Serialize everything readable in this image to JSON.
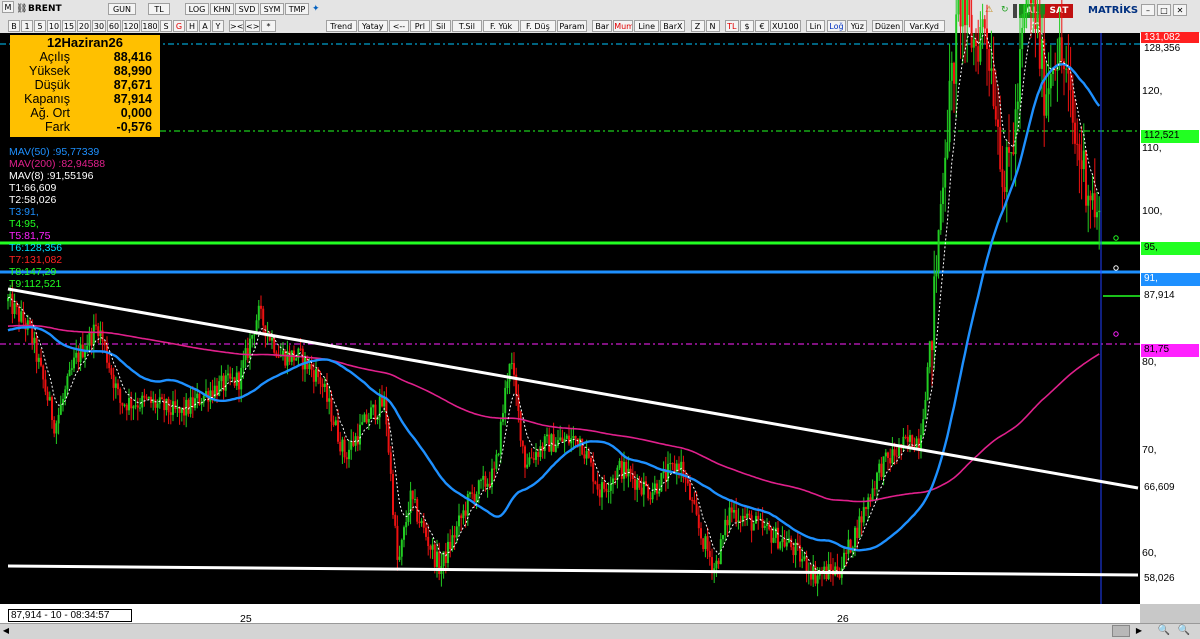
{
  "toolbar": {
    "menu_icon": "M",
    "symbol": "BRENT",
    "period_tabs": [
      "GUN",
      "TL",
      "LOG",
      "KHN",
      "SVD",
      "SYM",
      "TMP"
    ],
    "row2_left": [
      "B",
      "1",
      "5",
      "10",
      "15",
      "20",
      "30",
      "60",
      "120",
      "180",
      "S",
      "G",
      "H",
      "A",
      "Y"
    ],
    "nav_buttons": [
      "><",
      "<>",
      "*"
    ],
    "row2_buttons": [
      "Trend",
      "Yatay",
      "<--",
      "Prl",
      "Sil",
      "T.Sil",
      "F. Yük",
      "F. Düş",
      "Param",
      "Bar",
      "Mum",
      "Line",
      "BarX",
      "Z",
      "N",
      "TL",
      "$",
      "€",
      "XU100",
      "Lin",
      "Loğ",
      "Yüz",
      "Düzen",
      "Var.Kyd"
    ],
    "al_label": "AL",
    "sat_label": "SAT",
    "matriks_label": "MATRİKS"
  },
  "info_box": {
    "title": "12Haziran26",
    "rows": [
      {
        "label": "Açılış",
        "value": "88,416"
      },
      {
        "label": "Yüksek",
        "value": "88,990"
      },
      {
        "label": "Düşük",
        "value": "87,671"
      },
      {
        "label": "Kapanış",
        "value": "87,914"
      },
      {
        "label": "Ağ. Ort",
        "value": "0,000"
      },
      {
        "label": "Fark",
        "value": "-0,576"
      }
    ]
  },
  "indicators": [
    {
      "text": "MAV(50)    :95,77339",
      "color": "#1e90ff"
    },
    {
      "text": "MAV(200)   :82,94588",
      "color": "#e0208c"
    },
    {
      "text": "MAV(8)       :91,55196",
      "color": "#ffffff"
    },
    {
      "text": "T1:66,609",
      "color": "#ffffff"
    },
    {
      "text": "T2:58,026",
      "color": "#ffffff"
    },
    {
      "text": "T3:91,",
      "color": "#1e90ff"
    },
    {
      "text": "T4:95,",
      "color": "#22ff22"
    },
    {
      "text": "T5:81,75",
      "color": "#ff22ff"
    },
    {
      "text": "T6:128,356",
      "color": "#00e0ff"
    },
    {
      "text": "T7:131,082",
      "color": "#ff2222"
    },
    {
      "text": "T8:147,29",
      "color": "#22ff22"
    },
    {
      "text": "T9:112,521",
      "color": "#22ff22"
    }
  ],
  "y_axis_ticks": [
    "120,",
    "110,",
    "100,",
    "80,",
    "70,",
    "60,"
  ],
  "x_axis_ticks": [
    "25",
    "26"
  ],
  "price_tags": [
    {
      "id": "t7",
      "text": "131,082",
      "bg": "#ff2020",
      "fg": "#ffffff"
    },
    {
      "id": "t6",
      "text": "128,356",
      "bg": "#ffffff",
      "fg": "#000000"
    },
    {
      "id": "t9",
      "text": "112,521",
      "bg": "#22ff22",
      "fg": "#000000"
    },
    {
      "id": "t4",
      "text": "95,",
      "bg": "#22ff22",
      "fg": "#000000"
    },
    {
      "id": "t3",
      "text": "91,",
      "bg": "#1e90ff",
      "fg": "#ffffff"
    },
    {
      "id": "last",
      "text": "87,914",
      "bg": "#ffffff",
      "fg": "#000000"
    },
    {
      "id": "t5",
      "text": "81,75",
      "bg": "#ff22ff",
      "fg": "#000000"
    },
    {
      "id": "t1",
      "text": "66,609",
      "bg": "#ffffff",
      "fg": "#000000"
    },
    {
      "id": "t2",
      "text": "58,026",
      "bg": "#ffffff",
      "fg": "#000000"
    }
  ],
  "status_text": "87,914 - 10 - 08:34:57",
  "colors": {
    "background": "#000000",
    "candle_up": "#22cc22",
    "candle_down": "#ee1111",
    "mav50": "#1e90ff",
    "mav200": "#e0208c",
    "mav8": "#ffffff",
    "trendline": "#ffffff"
  }
}
